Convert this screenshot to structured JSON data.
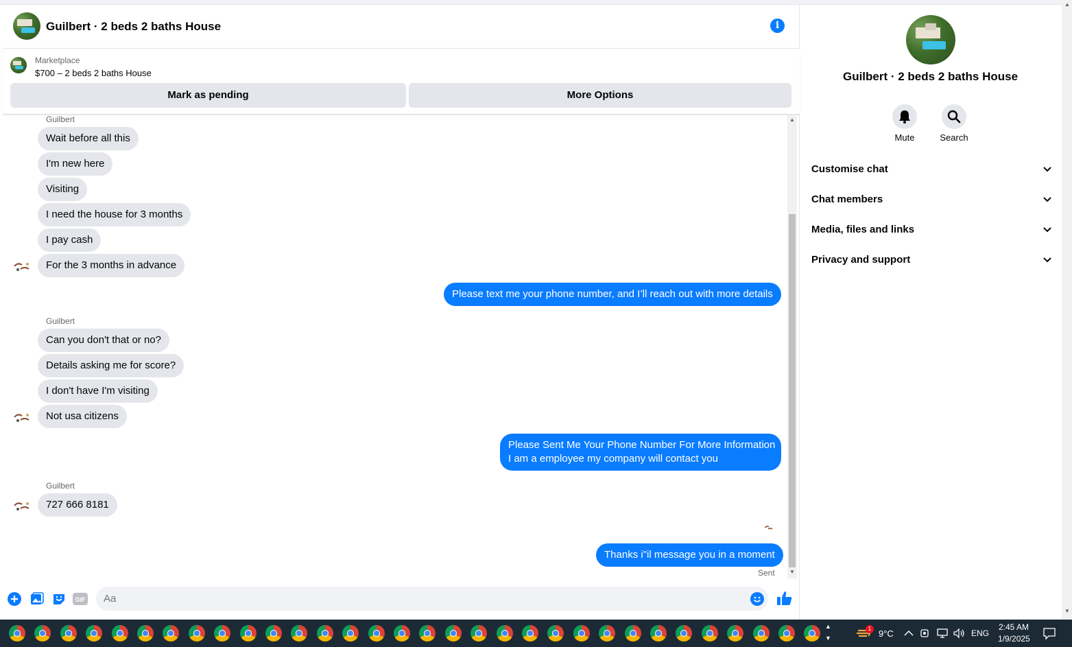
{
  "header": {
    "title": "Guilbert · 2 beds 2 baths House"
  },
  "marketplace": {
    "label": "Marketplace",
    "listing": "$700 – 2 beds 2 baths House",
    "pending_button": "Mark as pending",
    "options_button": "More Options"
  },
  "conversation": {
    "sender_name": "Guilbert",
    "group1": [
      "Wait before all this",
      "I'm new here",
      "Visiting",
      "I need the house for 3 months",
      "I pay cash",
      "For the 3 months in advance"
    ],
    "reply1": "Please text me your phone number, and I’ll reach out with more details",
    "group2": [
      "Can you don't that or no?",
      "Details asking me for score?",
      "I don't have I'm visiting",
      "Not usa citizens"
    ],
    "reply2_line1": "Please Sent Me Your Phone Number For More Information",
    "reply2_line2": "I am a employee my company will contact you",
    "group3": [
      "727 666 8181"
    ],
    "reply3": "Thanks i\"il message you in a moment",
    "status": "Sent"
  },
  "composer": {
    "placeholder": "Aa"
  },
  "sidebar": {
    "title": "Guilbert · 2 beds 2 baths House",
    "actions": {
      "mute": "Mute",
      "search": "Search"
    },
    "sections": [
      "Customise chat",
      "Chat members",
      "Media, files and links",
      "Privacy and support"
    ]
  },
  "taskbar": {
    "weather": "9°C",
    "weather_badge": "1",
    "language": "ENG",
    "time": "2:45 AM",
    "date": "1/9/2025",
    "app_icon": "chrome-icon",
    "app_count": 32
  },
  "colors": {
    "accent": "#0a7cff",
    "incoming_bubble": "#e4e6eb",
    "taskbar": "#1c2a36"
  }
}
